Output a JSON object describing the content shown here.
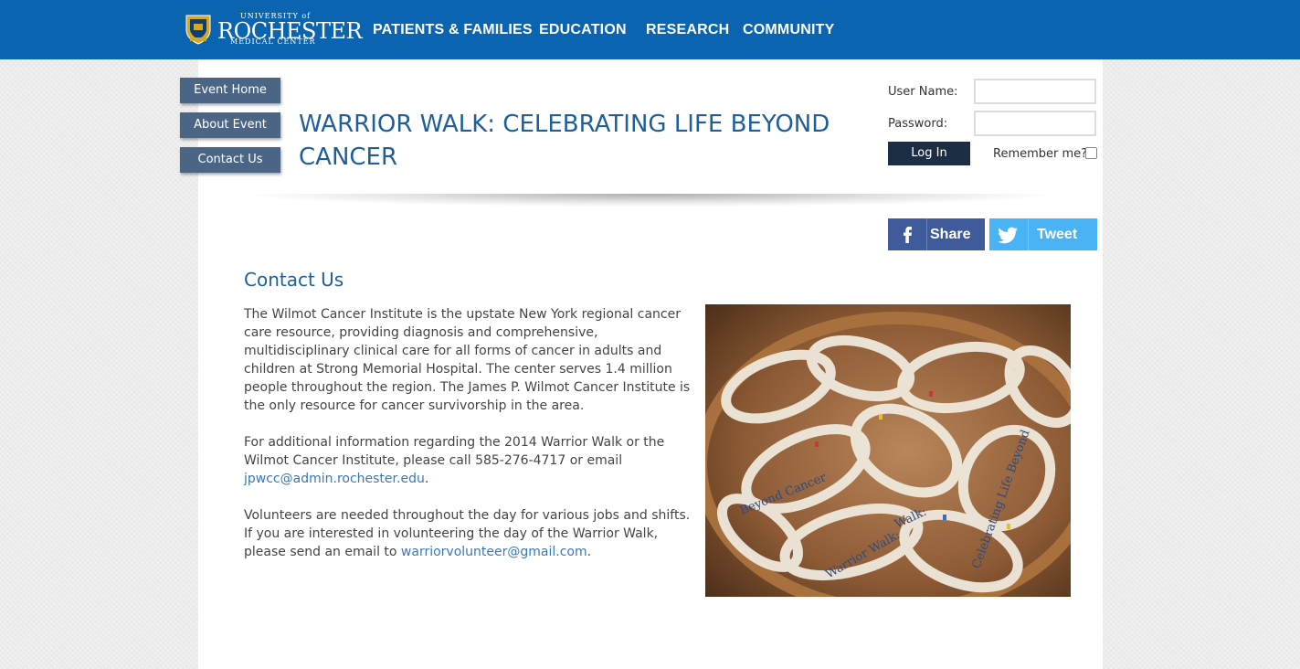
{
  "header": {
    "logo": {
      "line1": "UNIVERSITY of",
      "line2": "ROCHESTER",
      "line3": "MEDICAL CENTER"
    },
    "nav": [
      "PATIENTS & FAMILIES",
      "EDUCATION",
      "RESEARCH",
      "COMMUNITY"
    ]
  },
  "sidebar": {
    "items": [
      {
        "label": "Event Home"
      },
      {
        "label": "About Event"
      },
      {
        "label": "Contact Us"
      }
    ]
  },
  "page": {
    "title": "WARRIOR WALK: CELEBRATING LIFE BEYOND CANCER"
  },
  "login": {
    "username_label": "User Name:",
    "password_label": "Password:",
    "username_value": "",
    "password_value": "",
    "login_button": "Log In",
    "remember_label": "Remember me?",
    "remember_checked": false
  },
  "social": {
    "facebook_label": "Share",
    "twitter_label": "Tweet",
    "facebook_color": "#3f5b9b",
    "twitter_color": "#4ab3f4"
  },
  "content": {
    "heading": "Contact Us",
    "para1": "The Wilmot Cancer Institute is the upstate New York regional cancer care resource, providing diagnosis and comprehensive, multidisciplinary clinical care for all forms of cancer in adults and children at Strong Memorial  Hospital.  The center serves 1.4 million people throughout the region.  The James P. Wilmot Cancer Institute is the only resource for cancer survivorship in the area.",
    "para2_text": "For additional information regarding the 2014 Warrior Walk or the Wilmot Cancer Institute, please call 585-276-4717 or email ",
    "para2_link": "jpwcc@admin.rochester.edu",
    "para2_end": ".",
    "para3_text": "Volunteers are needed throughout the day for various jobs and shifts. If you are interested in volunteering the day of the Warrior Walk, please send an email to ",
    "para3_link": "warriorvolunteer@gmail.com",
    "para3_end": "."
  },
  "photo": {
    "band_texts": [
      "Celebrating Life Beyond",
      "Beyond Cancer",
      "Walk:",
      "Warrior Walk:"
    ]
  },
  "colors": {
    "header_blue": "#0a64b0",
    "sidebar_button": "#4b6584",
    "title_blue": "#1f5f99",
    "link_blue": "#3a78b5",
    "login_button": "#1c2e44"
  }
}
